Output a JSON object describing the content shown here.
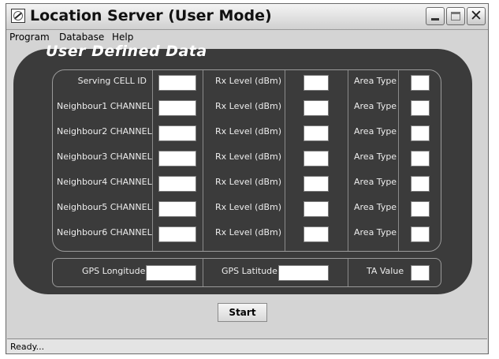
{
  "window": {
    "title": "Location Server (User Mode)"
  },
  "menu": {
    "program": "Program",
    "database": "Database",
    "help": "Help"
  },
  "panel": {
    "title": "User Defined Data"
  },
  "rows": [
    {
      "label": "Serving CELL ID",
      "rx_label": "Rx Level (dBm)",
      "area_label": "Area Type"
    },
    {
      "label": "Neighbour1 CHANNEL",
      "rx_label": "Rx Level (dBm)",
      "area_label": "Area Type"
    },
    {
      "label": "Neighbour2 CHANNEL",
      "rx_label": "Rx Level (dBm)",
      "area_label": "Area Type"
    },
    {
      "label": "Neighbour3 CHANNEL",
      "rx_label": "Rx Level (dBm)",
      "area_label": "Area Type"
    },
    {
      "label": "Neighbour4 CHANNEL",
      "rx_label": "Rx Level (dBm)",
      "area_label": "Area Type"
    },
    {
      "label": "Neighbour5 CHANNEL",
      "rx_label": "Rx Level (dBm)",
      "area_label": "Area Type"
    },
    {
      "label": "Neighbour6 CHANNEL",
      "rx_label": "Rx Level (dBm)",
      "area_label": "Area Type"
    }
  ],
  "gps": {
    "longitude_label": "GPS Longitude",
    "latitude_label": "GPS Latitude",
    "ta_label": "TA Value"
  },
  "buttons": {
    "start": "Start"
  },
  "status": {
    "text": "Ready..."
  },
  "colors": {
    "panel_bg": "#3b3b3b",
    "window_bg": "#d4d4d4"
  },
  "icons": {
    "app": "antenna-icon",
    "minimize": "minimize-icon",
    "maximize": "maximize-icon",
    "close": "close-icon"
  }
}
